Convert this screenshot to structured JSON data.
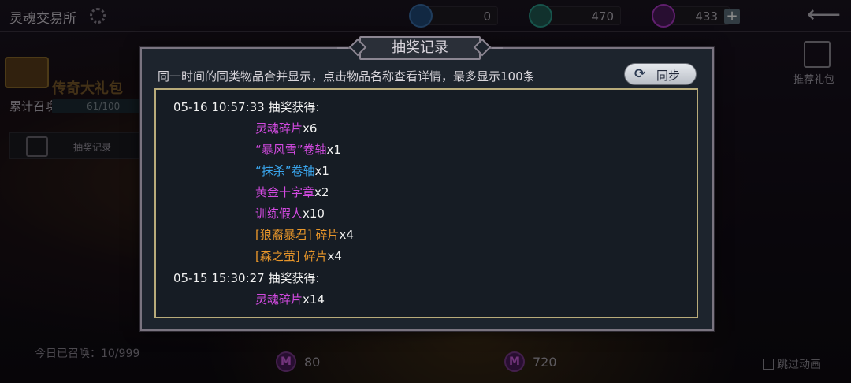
{
  "header": {
    "title": "灵魂交易所"
  },
  "resources": [
    {
      "icon": "compass-coin-icon",
      "value": "0",
      "color": "#3a6ea8"
    },
    {
      "icon": "gem-icon",
      "value": "470",
      "color": "#2a9a8a"
    },
    {
      "icon": "soul-crystal-icon",
      "value": "433",
      "color": "#b03ac8"
    }
  ],
  "left": {
    "banner": "传奇大礼包",
    "accum_label": "累计召唤",
    "accum_count": "61/100",
    "record_label": "抽奖记录"
  },
  "right_gift_label": "推荐礼包",
  "footer": {
    "today": "今日已召唤：10/999",
    "cost1": "80",
    "cost2": "720",
    "skip": "跳过动画"
  },
  "modal": {
    "title": "抽奖记录",
    "hint": "同一时间的同类物品合并显示，点击物品名称查看详情，最多显示100条",
    "sync_label": "同步",
    "entries": [
      {
        "header": "05-16 10:57:33  抽奖获得:",
        "items": [
          {
            "name": "灵魂碎片",
            "qty": "x6",
            "color": "#d24ae0"
          },
          {
            "name": "“暴风雪”卷轴",
            "qty": "x1",
            "color": "#d24ae0"
          },
          {
            "name": "“抹杀”卷轴",
            "qty": "x1",
            "color": "#3aa6ee"
          },
          {
            "name": "黄金十字章",
            "qty": "x2",
            "color": "#d24ae0"
          },
          {
            "name": "训练假人",
            "qty": "x10",
            "color": "#d24ae0"
          },
          {
            "name": "[狼裔暴君] 碎片",
            "qty": "x4",
            "color": "#e8962a"
          },
          {
            "name": "[森之萤] 碎片",
            "qty": "x4",
            "color": "#e8962a"
          }
        ]
      },
      {
        "header": "05-15 15:30:27  抽奖获得:",
        "items": [
          {
            "name": "灵魂碎片",
            "qty": "x14",
            "color": "#d24ae0"
          }
        ]
      }
    ]
  }
}
